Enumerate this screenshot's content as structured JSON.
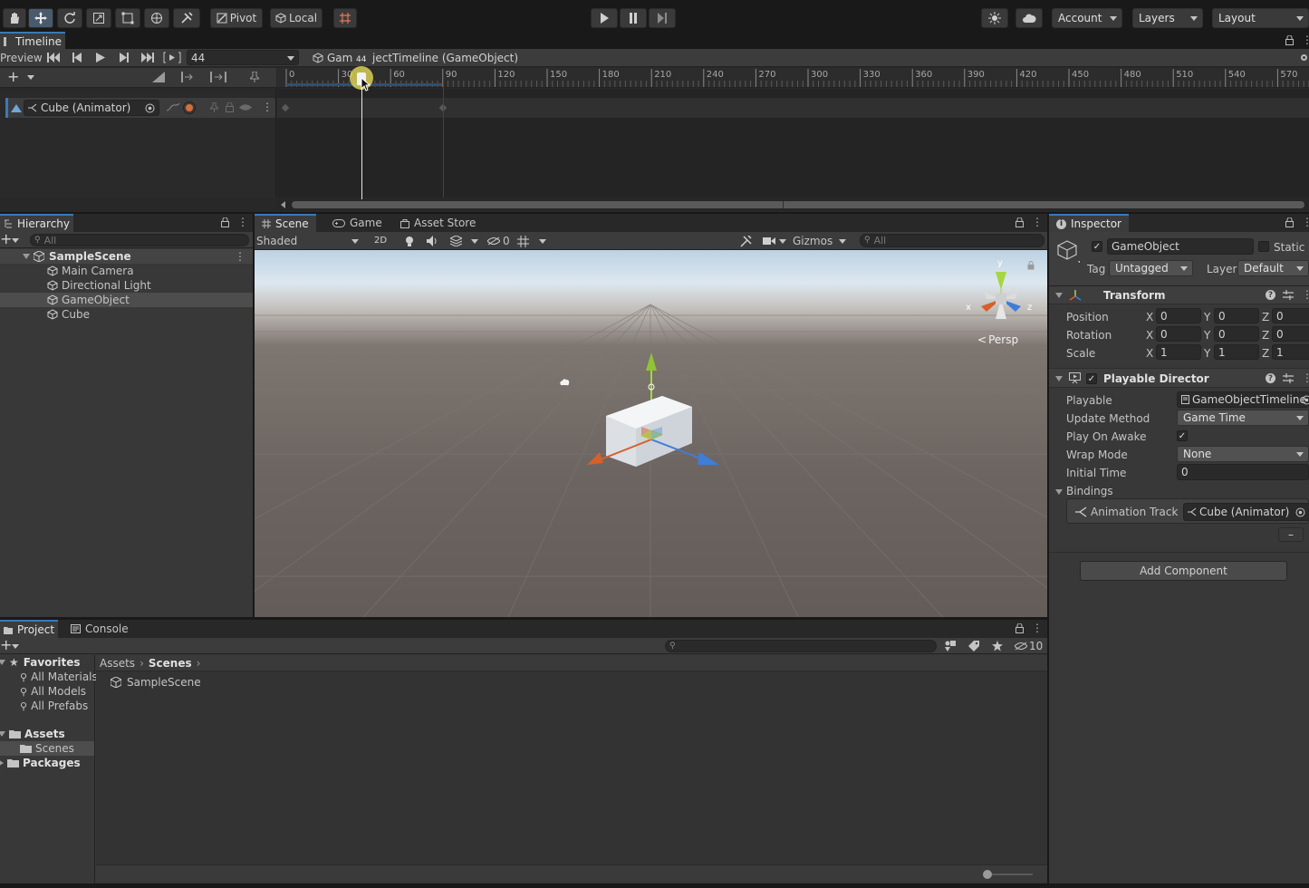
{
  "toolbar": {
    "pivot_label": "Pivot",
    "local_label": "Local",
    "account_label": "Account",
    "layers_label": "Layers",
    "layout_label": "Layout"
  },
  "timeline": {
    "tab_label": "Timeline",
    "preview_label": "Preview",
    "frame_value": "44",
    "asset_label": "GameObjectTimeline (GameObject)",
    "asset_prefix": "Gam",
    "asset_suffix": "jectTimeline (GameObject)",
    "playhead_label": "44",
    "ruler_ticks": [
      "0",
      "30",
      "60",
      "90",
      "120",
      "150",
      "180",
      "210",
      "240",
      "270",
      "300",
      "330",
      "360",
      "390",
      "420",
      "450",
      "480",
      "510",
      "540",
      "570"
    ],
    "track_name": "Cube (Animator)"
  },
  "hierarchy": {
    "tab_label": "Hierarchy",
    "search_placeholder": "All",
    "scene_name": "SampleScene",
    "items": [
      "Main Camera",
      "Directional Light",
      "GameObject",
      "Cube"
    ],
    "selected": "GameObject"
  },
  "scene_view": {
    "tabs": [
      "Scene",
      "Game",
      "Asset Store"
    ],
    "shading_mode": "Shaded",
    "mode_2d": "2D",
    "hidden_count": "0",
    "gizmos_label": "Gizmos",
    "search_placeholder": "All",
    "persp_label": "Persp",
    "axis_labels": [
      "x",
      "y",
      "z"
    ]
  },
  "inspector": {
    "tab_label": "Inspector",
    "object_name": "GameObject",
    "static_label": "Static",
    "tag_label": "Tag",
    "tag_value": "Untagged",
    "layer_label": "Layer",
    "layer_value": "Default",
    "transform": {
      "title": "Transform",
      "rows": [
        {
          "label": "Position",
          "x": "0",
          "y": "0",
          "z": "0"
        },
        {
          "label": "Rotation",
          "x": "0",
          "y": "0",
          "z": "0"
        },
        {
          "label": "Scale",
          "x": "1",
          "y": "1",
          "z": "1"
        }
      ]
    },
    "playable_director": {
      "title": "Playable Director",
      "playable_label": "Playable",
      "playable_value": "GameObjectTimeline",
      "update_method_label": "Update Method",
      "update_method_value": "Game Time",
      "play_on_awake_label": "Play On Awake",
      "wrap_mode_label": "Wrap Mode",
      "wrap_mode_value": "None",
      "initial_time_label": "Initial Time",
      "initial_time_value": "0",
      "bindings_label": "Bindings",
      "binding_track_label": "Animation Track",
      "binding_value": "Cube (Animator)",
      "remove_label": "–"
    },
    "add_component_label": "Add Component"
  },
  "project": {
    "tabs": [
      "Project",
      "Console"
    ],
    "favorites_label": "Favorites",
    "favorites": [
      "All Materials",
      "All Models",
      "All Prefabs"
    ],
    "assets_label": "Assets",
    "assets_children": [
      "Scenes"
    ],
    "packages_label": "Packages",
    "breadcrumb": [
      "Assets",
      "Scenes"
    ],
    "files": [
      "SampleScene"
    ],
    "hidden_count": "10"
  },
  "colors": {
    "accent": "#3a79bb",
    "selection": "#2c5d87",
    "panel": "#383838",
    "toolbar": "#191919"
  }
}
